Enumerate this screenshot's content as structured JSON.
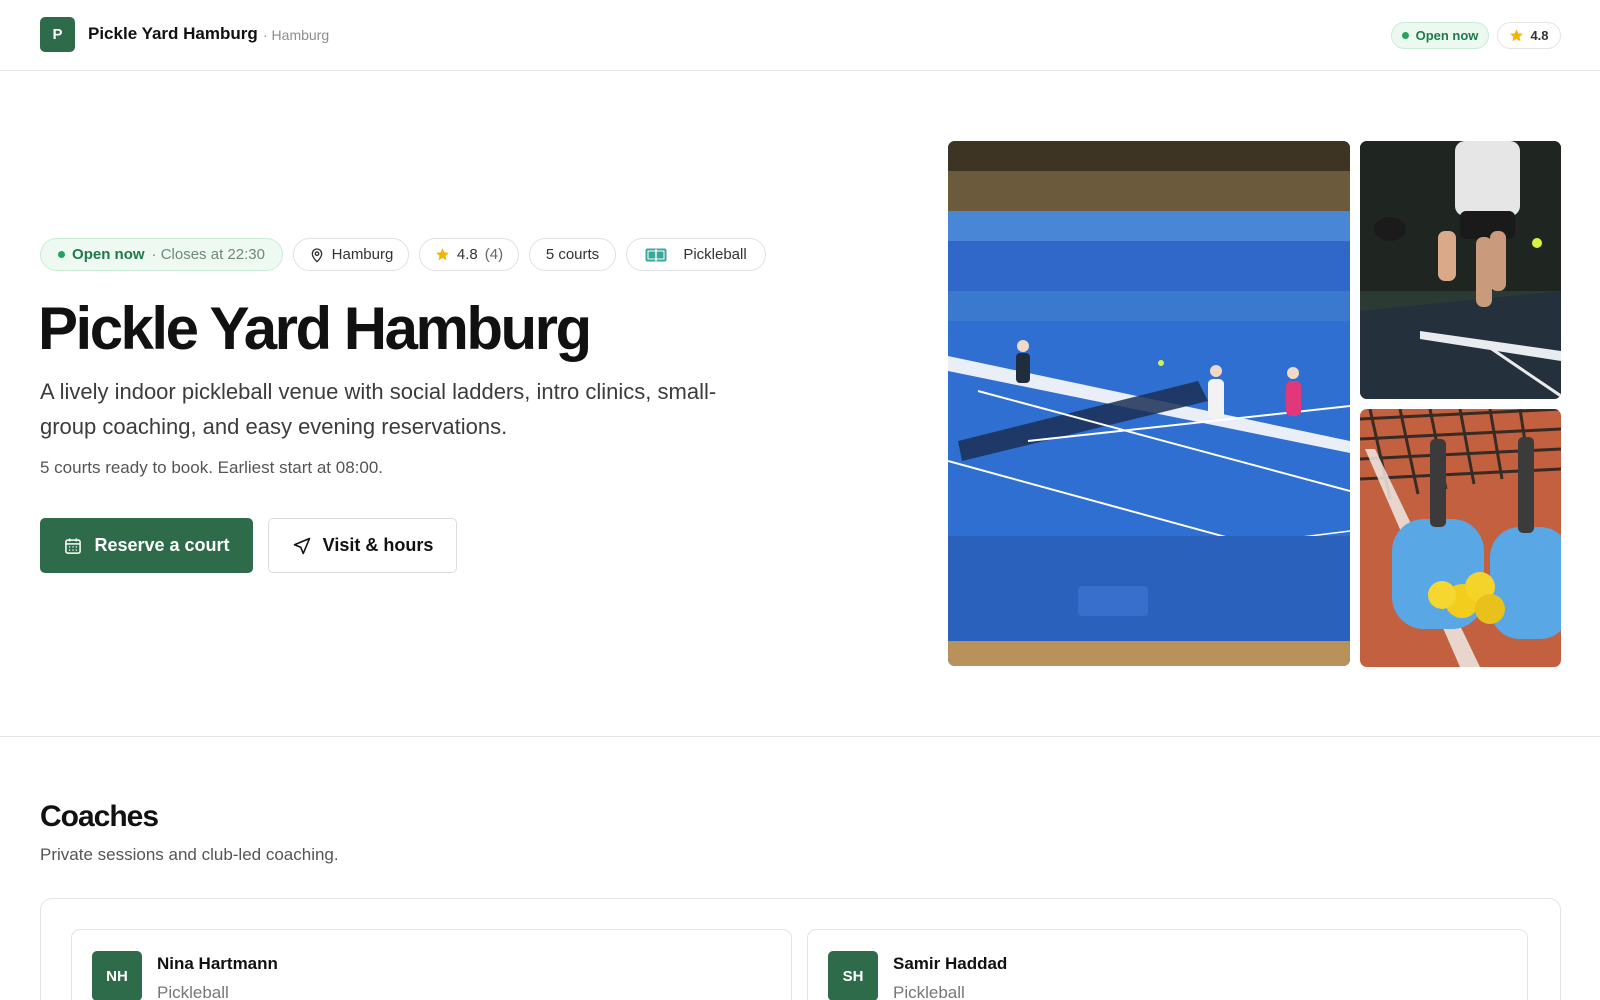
{
  "header": {
    "logo_letter": "P",
    "venue_name": "Pickle Yard Hamburg",
    "city": "· Hamburg",
    "status": "Open now",
    "rating": "4.8"
  },
  "hero": {
    "status_label": "Open now",
    "closes": "· Closes at 22:30",
    "city": "Hamburg",
    "rating": "4.8",
    "review_count": "(4)",
    "courts": "5 courts",
    "sport": "Pickleball",
    "title": "Pickle Yard Hamburg",
    "description": "A lively indoor pickleball venue with social ladders, intro clinics, small-group coaching, and easy evening reservations.",
    "meta": "5 courts ready to book. Earliest start at 08:00.",
    "primary_cta": "Reserve a court",
    "secondary_cta": "Visit & hours"
  },
  "coaches": {
    "title": "Coaches",
    "subtitle": "Private sessions and club-led coaching.",
    "items": [
      {
        "initials": "NH",
        "name": "Nina Hartmann",
        "sport": "Pickleball"
      },
      {
        "initials": "SH",
        "name": "Samir Haddad",
        "sport": "Pickleball"
      }
    ]
  },
  "icons": {
    "status": "green-dot-icon",
    "rating": "star-icon",
    "city": "map-pin-icon",
    "sport": "court-icon",
    "primary_cta": "calendar-icon",
    "secondary_cta": "navigation-arrow-icon"
  },
  "colors": {
    "brand": "#2e6b4a",
    "open_status": "#1f7a49",
    "star": "#f4b400"
  }
}
